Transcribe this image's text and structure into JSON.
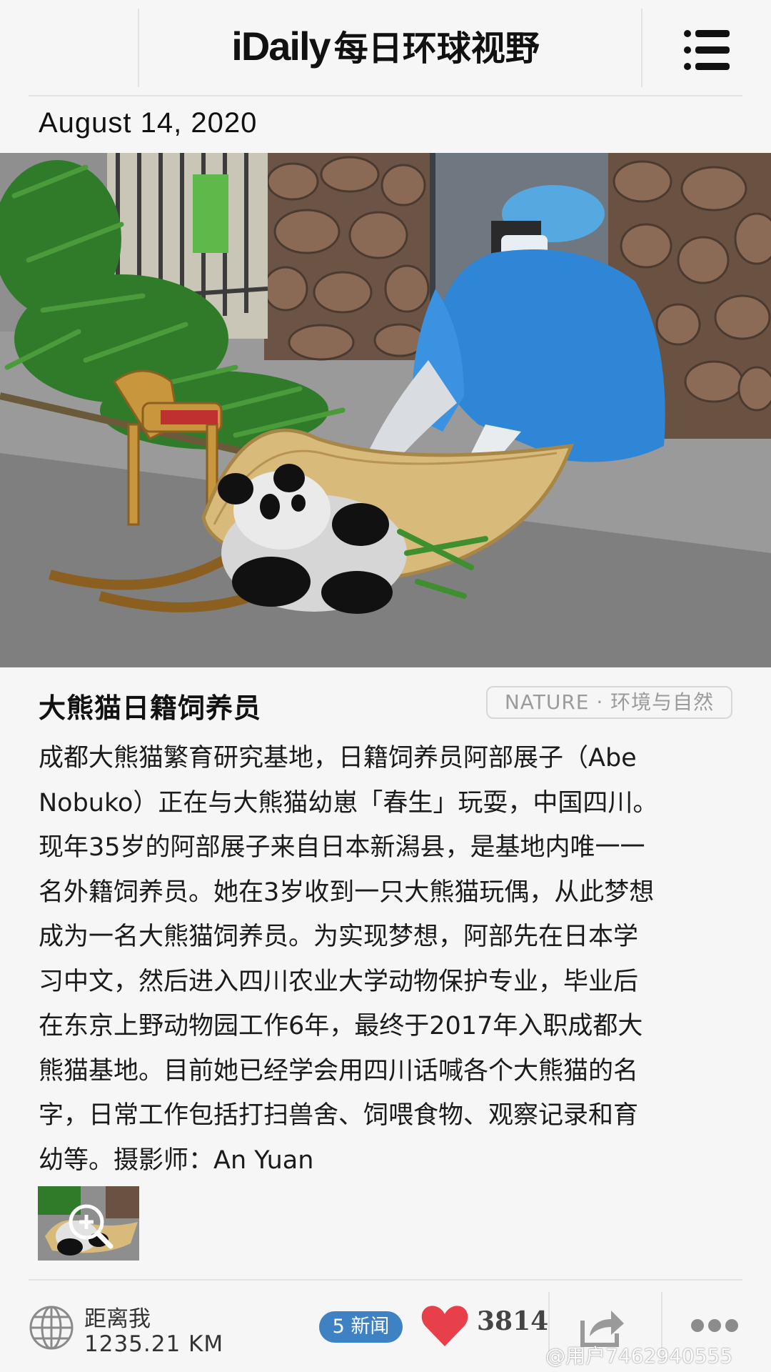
{
  "header": {
    "brand_en": "iDaily",
    "brand_cn": "每日环球视野",
    "menu_icon": "menu-icon"
  },
  "date": "August 14, 2020",
  "article": {
    "title": "大熊猫日籍饲养员",
    "tag": "NATURE · 环境与自然",
    "body_lines": [
      "成都大熊猫繁育研究基地，日籍饲养员阿部展子（Abe",
      "Nobuko）正在与大熊猫幼崽「春生」玩耍，中国四川。",
      "现年35岁的阿部展子来自日本新潟县，是基地内唯一一",
      "名外籍饲养员。她在3岁收到一只大熊猫玩偶，从此梦想",
      "成为一名大熊猫饲养员。为实现梦想，阿部先在日本学",
      "习中文，然后进入四川农业大学动物保护专业，毕业后",
      "在东京上野动物园工作6年，最终于2017年入职成都大",
      "熊猫基地。目前她已经学会用四川话喊各个大熊猫的名",
      "字，日常工作包括打扫兽舍、饲喂食物、观察记录和育",
      "幼等。摄影师：An Yuan"
    ]
  },
  "footer": {
    "distance_label": "距离我",
    "distance_value": "1235.21 KM",
    "news_badge": "5 新闻",
    "likes": "3814",
    "watermark": "@用户7462940555"
  },
  "colors": {
    "background": "#f6f6f6",
    "badge_blue": "#3f82c4",
    "heart_red": "#e8404a",
    "tag_gray": "#9b9b9b"
  }
}
